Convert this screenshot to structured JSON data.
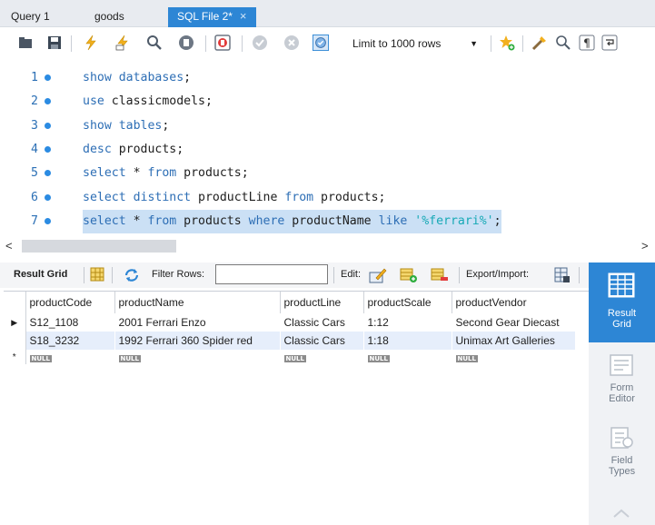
{
  "tabs": [
    {
      "label": "Query 1"
    },
    {
      "label": "goods"
    },
    {
      "label": "SQL File 2*"
    }
  ],
  "tab_close_glyph": "×",
  "toolbar": {
    "icons": [
      "open-folder-icon",
      "save-icon",
      "execute-icon",
      "execute-selection-icon",
      "explain-icon",
      "stop-icon",
      "toggle-continue-on-error-icon",
      "commit-icon",
      "rollback-icon",
      "autocommit-icon",
      "bookmark-icon",
      "beautify-icon",
      "find-icon",
      "invisible-chars-icon",
      "word-wrap-icon"
    ],
    "limit_label": "Limit to 1000 rows"
  },
  "editor": {
    "lines": [
      {
        "num": "1",
        "parts": [
          {
            "t": "show databases",
            "c": "kw"
          },
          {
            "t": ";",
            "c": "plain"
          }
        ]
      },
      {
        "num": "2",
        "parts": [
          {
            "t": "use ",
            "c": "kw"
          },
          {
            "t": "classicmodels;",
            "c": "plain"
          }
        ]
      },
      {
        "num": "3",
        "parts": [
          {
            "t": "show tables",
            "c": "kw"
          },
          {
            "t": ";",
            "c": "plain"
          }
        ]
      },
      {
        "num": "4",
        "parts": [
          {
            "t": "desc ",
            "c": "kw"
          },
          {
            "t": "products;",
            "c": "plain"
          }
        ]
      },
      {
        "num": "5",
        "parts": [
          {
            "t": "select ",
            "c": "kw"
          },
          {
            "t": "* ",
            "c": "plain"
          },
          {
            "t": "from ",
            "c": "kw"
          },
          {
            "t": "products;",
            "c": "plain"
          }
        ]
      },
      {
        "num": "6",
        "parts": [
          {
            "t": "select distinct ",
            "c": "kw"
          },
          {
            "t": "productLine ",
            "c": "plain"
          },
          {
            "t": "from ",
            "c": "kw"
          },
          {
            "t": "products;",
            "c": "plain"
          }
        ]
      },
      {
        "num": "7",
        "highlight": true,
        "parts": [
          {
            "t": "select ",
            "c": "kw"
          },
          {
            "t": "* ",
            "c": "plain"
          },
          {
            "t": "from ",
            "c": "kw"
          },
          {
            "t": "products ",
            "c": "plain"
          },
          {
            "t": "where ",
            "c": "kw"
          },
          {
            "t": "productName ",
            "c": "plain"
          },
          {
            "t": "like ",
            "c": "kw"
          },
          {
            "t": "'%ferrari%'",
            "c": "str"
          },
          {
            "t": ";",
            "c": "plain"
          }
        ]
      }
    ]
  },
  "scroll": {
    "left_arrow": "<",
    "right_arrow": ">"
  },
  "result_toolbar": {
    "result_grid_label": "Result Grid",
    "filter_rows_label": "Filter Rows:",
    "filter_value": "",
    "edit_label": "Edit:",
    "export_label": "Export/Import:"
  },
  "grid": {
    "columns": [
      "productCode",
      "productName",
      "productLine",
      "productScale",
      "productVendor"
    ],
    "rows": [
      [
        "S12_1108",
        "2001 Ferrari Enzo",
        "Classic Cars",
        "1:12",
        "Second Gear Diecast"
      ],
      [
        "S18_3232",
        "1992 Ferrari 360 Spider red",
        "Classic Cars",
        "1:18",
        "Unimax Art Galleries"
      ]
    ],
    "null_label": "NULL",
    "current_row_marker": "▶",
    "new_row_marker": "*"
  },
  "side_panel": [
    {
      "label_1": "Result",
      "label_2": "Grid",
      "icon": "result-grid-icon"
    },
    {
      "label_1": "Form",
      "label_2": "Editor",
      "icon": "form-editor-icon"
    },
    {
      "label_1": "Field",
      "label_2": "Types",
      "icon": "field-types-icon"
    }
  ]
}
